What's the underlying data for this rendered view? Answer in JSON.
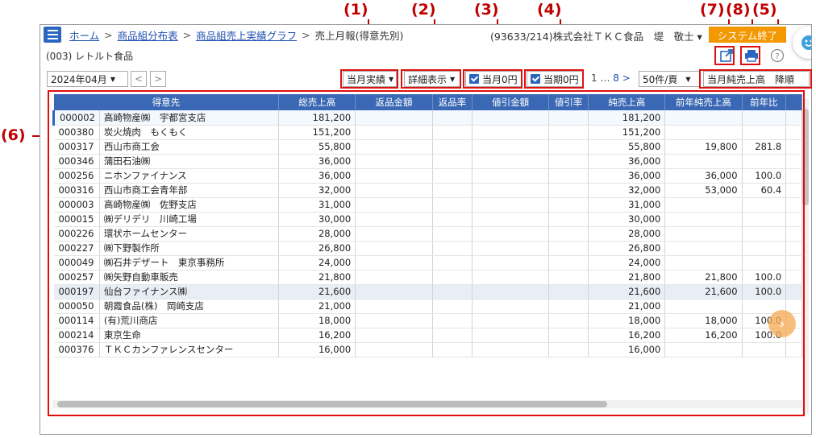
{
  "annotations": {
    "a1": "(1)",
    "a2": "(2)",
    "a3": "(3)",
    "a4": "(4)",
    "a7": "(7)",
    "a8": "(8)",
    "a5": "(5)",
    "a6": "(6)"
  },
  "header": {
    "breadcrumbs": [
      "ホーム",
      "商品組分布表",
      "商品組売上実績グラフ"
    ],
    "current": "売上月報(得意先別)",
    "separator": ">",
    "company": "(93633/214)株式会社ＴＫＣ食品　堤　敬士 ▾",
    "system_end": "システム終了"
  },
  "subtitle": "(003) レトルト食品",
  "toolbar": {
    "month": "2024年04月",
    "prev": "<",
    "next": ">",
    "period_mode": "当月実績",
    "detail_mode": "詳細表示",
    "zero_month": "当月0円",
    "zero_period": "当期0円",
    "pager_first": "1",
    "pager_ellipsis": "…",
    "pager_last": "8",
    "pager_next": ">",
    "per_page": "50件/頁",
    "sort": "当月純売上高　降順"
  },
  "table": {
    "columns": [
      "得意先",
      "",
      "総売上高",
      "返品金額",
      "返品率",
      "値引金額",
      "値引率",
      "純売上高",
      "前年純売上高",
      "前年比"
    ],
    "rows": [
      [
        "000002",
        "高崎物産㈱　宇都宮支店",
        "181,200",
        "",
        "",
        "",
        "",
        "181,200",
        "",
        ""
      ],
      [
        "000380",
        "炭火焼肉　もくもく",
        "151,200",
        "",
        "",
        "",
        "",
        "151,200",
        "",
        ""
      ],
      [
        "000317",
        "西山市商工会",
        "55,800",
        "",
        "",
        "",
        "",
        "55,800",
        "19,800",
        "281.8"
      ],
      [
        "000346",
        "蒲田石油㈱",
        "36,000",
        "",
        "",
        "",
        "",
        "36,000",
        "",
        ""
      ],
      [
        "000256",
        "ニホンファイナンス",
        "36,000",
        "",
        "",
        "",
        "",
        "36,000",
        "36,000",
        "100.0"
      ],
      [
        "000316",
        "西山市商工会青年部",
        "32,000",
        "",
        "",
        "",
        "",
        "32,000",
        "53,000",
        "60.4"
      ],
      [
        "000003",
        "高崎物産㈱　佐野支店",
        "31,000",
        "",
        "",
        "",
        "",
        "31,000",
        "",
        ""
      ],
      [
        "000015",
        "㈱デリデリ　川崎工場",
        "30,000",
        "",
        "",
        "",
        "",
        "30,000",
        "",
        ""
      ],
      [
        "000226",
        "環状ホームセンター",
        "28,000",
        "",
        "",
        "",
        "",
        "28,000",
        "",
        ""
      ],
      [
        "000227",
        "㈱下野製作所",
        "26,800",
        "",
        "",
        "",
        "",
        "26,800",
        "",
        ""
      ],
      [
        "000049",
        "㈱石井デザート　東京事務所",
        "24,000",
        "",
        "",
        "",
        "",
        "24,000",
        "",
        ""
      ],
      [
        "000257",
        "㈱矢野自動車販売",
        "21,800",
        "",
        "",
        "",
        "",
        "21,800",
        "21,800",
        "100.0"
      ],
      [
        "000197",
        "仙台ファイナンス㈱",
        "21,600",
        "",
        "",
        "",
        "",
        "21,600",
        "21,600",
        "100.0"
      ],
      [
        "000050",
        "朝霞食品(株)　岡崎支店",
        "21,000",
        "",
        "",
        "",
        "",
        "21,000",
        "",
        ""
      ],
      [
        "000114",
        "(有)荒川商店",
        "18,000",
        "",
        "",
        "",
        "",
        "18,000",
        "18,000",
        "100.0"
      ],
      [
        "000214",
        "東京生命",
        "16,200",
        "",
        "",
        "",
        "",
        "16,200",
        "16,200",
        "100.0"
      ],
      [
        "000376",
        "ＴＫＣカンファレンスセンター",
        "16,000",
        "",
        "",
        "",
        "",
        "16,000",
        "",
        ""
      ]
    ]
  },
  "colors": {
    "accent": "#2a66c0",
    "header_bg": "#3a68b4",
    "system_end": "#f39800",
    "annotation": "#c00000"
  }
}
